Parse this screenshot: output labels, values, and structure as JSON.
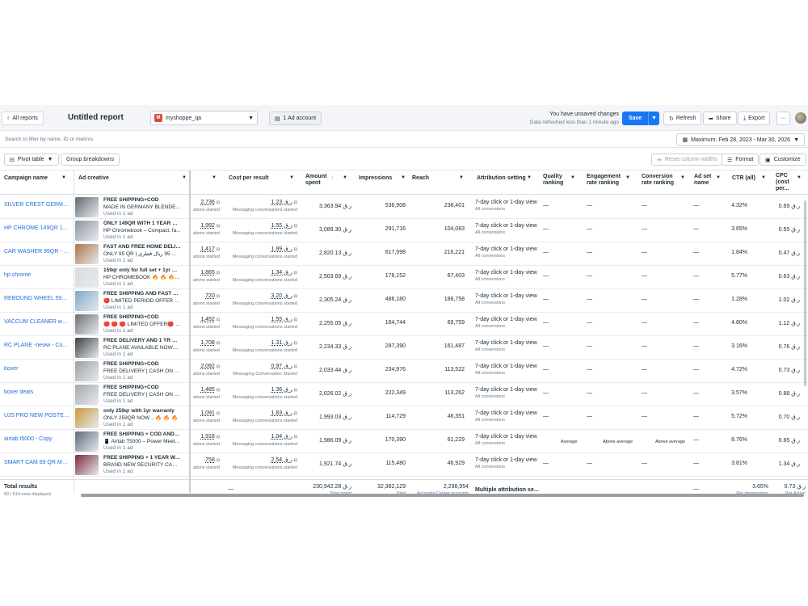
{
  "topbar": {
    "all_reports": "All reports",
    "title": "Untitled report",
    "account": "myshoppe_qa",
    "account_badge": "M",
    "ad_account": "1 Ad account",
    "unsaved_line1": "You have unsaved changes",
    "unsaved_line2": "Data refreshed less than 1 minute ago",
    "save": "Save",
    "refresh": "Refresh",
    "share": "Share",
    "export": "Export",
    "more": "···"
  },
  "search": {
    "placeholder": "Search to filter by name, ID or metrics",
    "date_range": "Maximum: Feb 28, 2023 - Mar 30, 2026"
  },
  "tools": {
    "pivot_table": "Pivot table",
    "group_breakdowns": "Group breakdowns",
    "reset_columns": "Reset column widths",
    "format": "Format",
    "customize": "Customize"
  },
  "headers": {
    "campaign_name": "Campaign name",
    "ad_creative": "Ad creative",
    "cost_per_result": "Cost per result",
    "amount_spent_1": "Amount",
    "amount_spent_2": "spent",
    "impressions": "Impressions",
    "reach": "Reach",
    "attribution": "Attribution setting",
    "quality_1": "Quality",
    "quality_2": "ranking",
    "engagement_1": "Engagement",
    "engagement_2": "rate ranking",
    "conversion_1": "Conversion",
    "conversion_2": "rate ranking",
    "adset_1": "Ad set",
    "adset_2": "name",
    "ctr": "CTR (all)",
    "cpc_1": "CPC",
    "cpc_2": "(cost",
    "cpc_3": "per..."
  },
  "rows": [
    {
      "name": "SILVER CREST GERMAN",
      "ad_h": "FREE SHIPPING+COD",
      "ad_s": "MADE IN GERMANY BLENDER ...",
      "ad_u": "Used in 1 ad",
      "results": "2,736",
      "results_sub": "ations started",
      "cpr": "1.23 ر.ق",
      "cpr_sub": "Messaging conversations started",
      "spent": "3,363.94 ر.ق",
      "impressions": "536,908",
      "reach": "238,401",
      "attr": "7-day click or 1-day view",
      "attr_sub": "All conversions",
      "quality": "—",
      "engagement": "—",
      "conversion": "—",
      "adset": "—",
      "ctr": "4.32%",
      "cpc": "0.69 ر.ق",
      "thumb": "#5f6a72"
    },
    {
      "name": "HP CHROME 149QR 14/...",
      "ad_h": "ONLY 149QR WITH 1 YEAR WA...",
      "ad_s": "HP Chromebook – Compact, fa...",
      "ad_u": "Used in 1 ad",
      "results": "1,992",
      "results_sub": "ations started",
      "cpr": "1.55 ر.ق",
      "cpr_sub": "Messaging conversations started",
      "spent": "3,089.30 ر.ق",
      "impressions": "291,716",
      "reach": "104,083",
      "attr": "7-day click or 1-day view",
      "attr_sub": "All conversions",
      "quality": "—",
      "engagement": "—",
      "conversion": "—",
      "adset": "—",
      "ctr": "3.65%",
      "cpc": "0.55 ر.ق",
      "thumb": "#8d96a1"
    },
    {
      "name": "CAR WASHER 99QR - P...",
      "ad_h": "FAST AND FREE HOME DELIVE...",
      "ad_s": "ONLY 95 QR | فقط 95 ريال قطري HIG...",
      "ad_u": "Used in 1 ad",
      "results": "1,417",
      "results_sub": "ations started",
      "cpr": "1.99 ر.ق",
      "cpr_sub": "Messaging conversations started",
      "spent": "2,820.13 ر.ق",
      "impressions": "617,998",
      "reach": "216,221",
      "attr": "7-day click or 1-day view",
      "attr_sub": "All conversions",
      "quality": "—",
      "engagement": "—",
      "conversion": "—",
      "adset": "—",
      "ctr": "1.84%",
      "cpc": "0.47 ر.ق",
      "thumb": "#a9754b"
    },
    {
      "name": "hp chrome",
      "ad_h": "159qr only for full set + 1yr war...",
      "ad_s": "HP CHROMEBOOK 🔥 🔥 🔥 fre...",
      "ad_u": "Used in 1 ad",
      "results": "1,865",
      "results_sub": "ations started",
      "cpr": "1.34 ر.ق",
      "cpr_sub": "Messaging conversations started",
      "spent": "2,503.69 ر.ق",
      "impressions": "178,152",
      "reach": "67,403",
      "attr": "7-day click or 1-day view",
      "attr_sub": "All conversions",
      "quality": "—",
      "engagement": "—",
      "conversion": "—",
      "adset": "—",
      "ctr": "5.77%",
      "cpc": "0.63 ر.ق",
      "thumb": "#d8dbe0"
    },
    {
      "name": "REBOUND WHEEL 59Q...",
      "ad_h": "FREE SHIPPING AND FAST DEL...",
      "ad_s": "🔴 LIMITED PERIOD OFFER 🔴 🔴",
      "ad_u": "Used in 1 ad",
      "results": "720",
      "results_sub": "ations started",
      "cpr": "3.20 ر.ق",
      "cpr_sub": "Messaging conversations started",
      "spent": "2,305.24 ر.ق",
      "impressions": "486,180",
      "reach": "188,758",
      "attr": "7-day click or 1-day view",
      "attr_sub": "All conversions",
      "quality": "—",
      "engagement": "—",
      "conversion": "—",
      "adset": "—",
      "ctr": "1.28%",
      "cpc": "1.02 ر.ق",
      "thumb": "#7fa7c9"
    },
    {
      "name": "VACCUM CLEANER wai...",
      "ad_h": "FREE SHIPPING+COD",
      "ad_s": "🔴 🔴 🔴 LIMITED OFFER🔴 🔴",
      "ad_u": "Used in 1 ad",
      "results": "1,452",
      "results_sub": "ations started",
      "cpr": "1.55 ر.ق",
      "cpr_sub": "Messaging conversations started",
      "spent": "2,255.05 ر.ق",
      "impressions": "164,744",
      "reach": "69,759",
      "attr": "7-day click or 1-day view",
      "attr_sub": "All conversions",
      "quality": "—",
      "engagement": "—",
      "conversion": "—",
      "adset": "—",
      "ctr": "4.80%",
      "cpc": "1.12 ر.ق",
      "thumb": "#6b6f75"
    },
    {
      "name": "RC PLANE -neww - Copy 3",
      "ad_h": "FREE DELIVERY AND 1 YR WAR...",
      "ad_s": "RC PLANE AVAILABLE NOW....",
      "ad_u": "Used in 1 ad",
      "results": "1,708",
      "results_sub": "ations started",
      "cpr": "1.31 ر.ق",
      "cpr_sub": "Messaging conversations started",
      "spent": "2,234.33 ر.ق",
      "impressions": "287,390",
      "reach": "161,487",
      "attr": "7-day click or 1-day view",
      "attr_sub": "All conversions",
      "quality": "—",
      "engagement": "—",
      "conversion": "—",
      "adset": "—",
      "ctr": "3.16%",
      "cpc": "0.76 ر.ق",
      "thumb": "#3c3f45"
    },
    {
      "name": "boxer",
      "ad_h": "FREE SHIPPING+COD",
      "ad_s": "FREE DELIVERY | CASH ON DEL...",
      "ad_u": "Used in 1 ad",
      "results": "2,092",
      "results_sub": "ations started",
      "cpr": "0.97 ر.ق",
      "cpr_sub": "Messaging Conversation Started",
      "spent": "2,033.44 ر.ق",
      "impressions": "234,976",
      "reach": "113,522",
      "attr": "7-day click or 1-day view",
      "attr_sub": "All conversions",
      "quality": "—",
      "engagement": "—",
      "conversion": "—",
      "adset": "—",
      "ctr": "4.72%",
      "cpc": "0.73 ر.ق",
      "thumb": "#9a9ea4"
    },
    {
      "name": "boxer deals",
      "ad_h": "FREE SHIPPING+COD",
      "ad_s": "FREE DELIVERY | CASH ON DEL...",
      "ad_u": "Used in 1 ad",
      "results": "1,485",
      "results_sub": "ations started",
      "cpr": "1.36 ر.ق",
      "cpr_sub": "Messaging conversations started",
      "spent": "2,026.02 ر.ق",
      "impressions": "222,349",
      "reach": "113,262",
      "attr": "7-day click or 1-day view",
      "attr_sub": "All conversions",
      "quality": "—",
      "engagement": "—",
      "conversion": "—",
      "adset": "—",
      "ctr": "3.57%",
      "cpc": "0.88 ر.ق",
      "thumb": "#a4a8ae"
    },
    {
      "name": "U25 PRO NEW POSTER ...",
      "ad_h": "only 259qr with 1yr warranty",
      "ad_s": "ONLY 259QR NOW .. 🔥 🔥 🔥",
      "ad_u": "Used in 1 ad",
      "results": "1,091",
      "results_sub": "ations started",
      "cpr": "1.83 ر.ق",
      "cpr_sub": "Messaging conversations started",
      "spent": "1,993.03 ر.ق",
      "impressions": "114,729",
      "reach": "46,351",
      "attr": "7-day click or 1-day view",
      "attr_sub": "All conversions",
      "quality": "—",
      "engagement": "—",
      "conversion": "—",
      "adset": "—",
      "ctr": "5.72%",
      "cpc": "0.70 ر.ق",
      "thumb": "#c99a3f"
    },
    {
      "name": "airtab t5000 - Copy",
      "ad_h": "FREE SHIPPING + COD AND 1 Y...",
      "ad_s": "📱 Airtab T5000 – Power Meet...",
      "ad_u": "Used in 1 ad",
      "results": "1,918",
      "results_sub": "ations started",
      "cpr": "1.04 ر.ق",
      "cpr_sub": "Messaging conversations started",
      "spent": "1,986.09 ر.ق",
      "impressions": "170,390",
      "reach": "61,229",
      "attr": "7-day click or 1-day view",
      "attr_sub": "All conversions",
      "quality": "Average",
      "engagement": "Above average",
      "conversion": "Above average",
      "adset": "—",
      "ctr": "8.76%",
      "cpc": "0.65 ر.ق",
      "thumb": "#5d6c7e"
    },
    {
      "name": "SMART CAM 89 QR MAIN",
      "ad_h": "FREE SHIPPING + 1 YEAR WAR...",
      "ad_s": "BRAND NEW SECURITY CAMER...",
      "ad_u": "Used in 1 ad",
      "results": "758",
      "results_sub": "ations started",
      "cpr": "2.54 ر.ق",
      "cpr_sub": "Messaging conversations started",
      "spent": "1,921.74 ر.ق",
      "impressions": "115,480",
      "reach": "46,929",
      "attr": "7-day click or 1-day view",
      "attr_sub": "All conversions",
      "quality": "—",
      "engagement": "—",
      "conversion": "—",
      "adset": "—",
      "ctr": "3.81%",
      "cpc": "1.34 ر.ق",
      "thumb": "#7b2a3a"
    }
  ],
  "totals": {
    "label": "Total results",
    "rows_displayed": "50 / 514 rows displayed",
    "cpr": "—",
    "spent": "230,942.28 ر.ق",
    "spent_sub": "Total spent",
    "impressions": "32,382,129",
    "impressions_sub": "Total",
    "reach": "2,298,954",
    "reach_sub": "Accounts Center accounts",
    "attr": "Multiple attribution se...",
    "adset": "—",
    "ctr": "3.65%",
    "ctr_sub": "Per Impressions",
    "cpc": "0.73 ر.ق",
    "cpc_sub": "Per Action"
  },
  "colors": {
    "accent": "#1877f2",
    "link": "#216fdb",
    "badge": "#e0483a"
  }
}
